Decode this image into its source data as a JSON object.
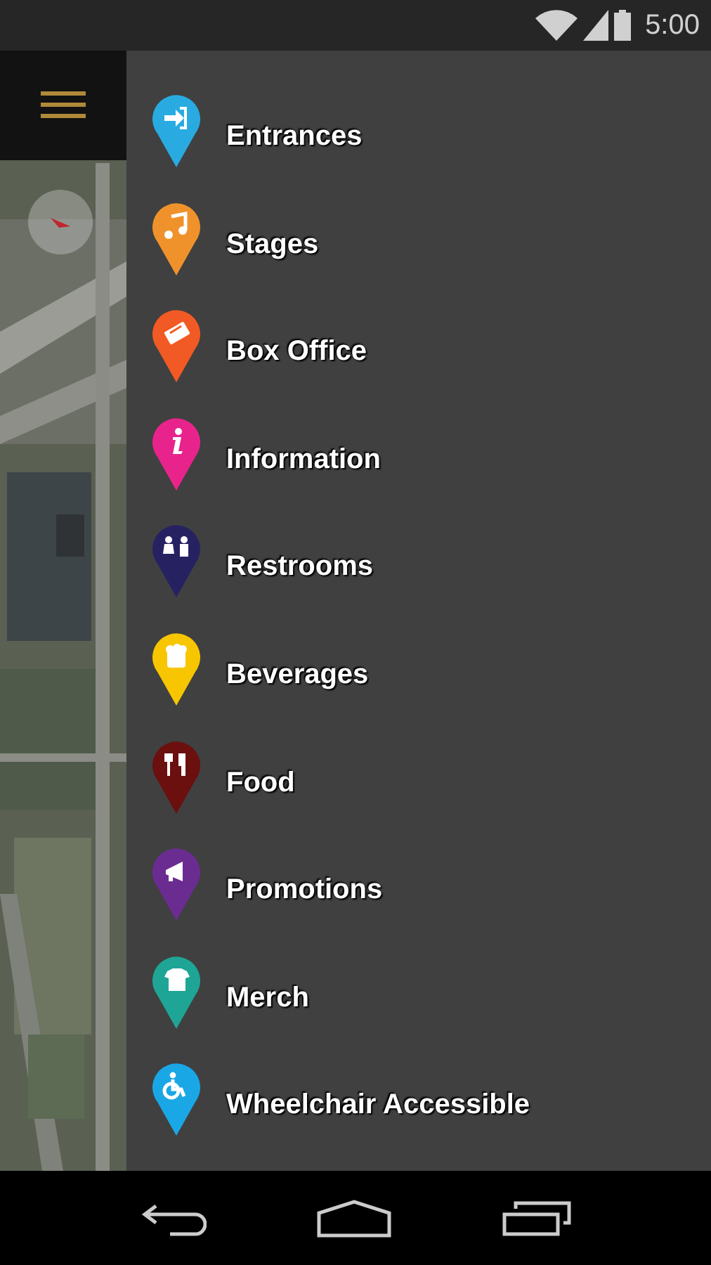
{
  "status_bar": {
    "time": "5:00"
  },
  "menu": {
    "items": [
      {
        "label": "Entrances",
        "color": "#29abe2"
      },
      {
        "label": "Stages",
        "color": "#f0922b"
      },
      {
        "label": "Box Office",
        "color": "#f15a24"
      },
      {
        "label": "Information",
        "color": "#e8248c"
      },
      {
        "label": "Restrooms",
        "color": "#262262"
      },
      {
        "label": "Beverages",
        "color": "#f7c600"
      },
      {
        "label": "Food",
        "color": "#6b0f0f"
      },
      {
        "label": "Promotions",
        "color": "#6a2c91"
      },
      {
        "label": "Merch",
        "color": "#1ea596"
      },
      {
        "label": "Wheelchair Accessible",
        "color": "#1aa7e6"
      }
    ]
  }
}
